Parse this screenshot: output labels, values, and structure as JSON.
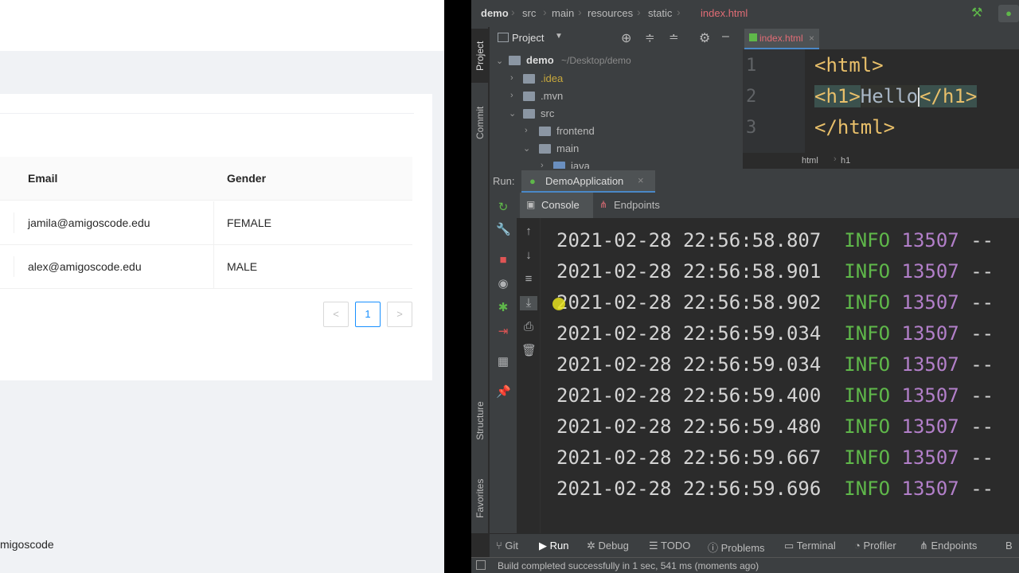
{
  "web": {
    "table": {
      "headers": [
        "Email",
        "Gender"
      ],
      "rows": [
        {
          "email": "jamila@amigoscode.edu",
          "gender": "FEMALE"
        },
        {
          "email": "alex@amigoscode.edu",
          "gender": "MALE"
        }
      ]
    },
    "pagination": {
      "prev": "<",
      "current": "1",
      "next": ">"
    },
    "footer": "migoscode"
  },
  "ide": {
    "breadcrumbs": [
      "demo",
      "src",
      "main",
      "resources",
      "static",
      "index.html"
    ],
    "left_tabs": [
      "Project",
      "Commit",
      "Structure",
      "Favorites"
    ],
    "project": {
      "header": "Project",
      "root_name": "demo",
      "root_path": "~/Desktop/demo",
      "items": [
        ".idea",
        ".mvn",
        "src",
        "frontend",
        "main",
        "java"
      ]
    },
    "editor": {
      "tab": "index.html",
      "line_numbers": [
        "1",
        "2",
        "3"
      ],
      "lines": {
        "l1": "<html>",
        "l2_open": "<h1>",
        "l2_text": "Hello",
        "l2_close": "</h1>",
        "l3": "</html>"
      },
      "crumbs": [
        "html",
        "h1"
      ]
    },
    "run": {
      "label": "Run:",
      "config": "DemoApplication",
      "tabs": [
        "Console",
        "Endpoints"
      ],
      "log": [
        {
          "ts": "2021-02-28 22:56:58.807",
          "level": "INFO",
          "pid": "13507",
          "rest": "--"
        },
        {
          "ts": "2021-02-28 22:56:58.901",
          "level": "INFO",
          "pid": "13507",
          "rest": "--"
        },
        {
          "ts": "2021-02-28 22:56:58.902",
          "level": "INFO",
          "pid": "13507",
          "rest": "--"
        },
        {
          "ts": "2021-02-28 22:56:59.034",
          "level": "INFO",
          "pid": "13507",
          "rest": "--"
        },
        {
          "ts": "2021-02-28 22:56:59.034",
          "level": "INFO",
          "pid": "13507",
          "rest": "--"
        },
        {
          "ts": "2021-02-28 22:56:59.400",
          "level": "INFO",
          "pid": "13507",
          "rest": "--"
        },
        {
          "ts": "2021-02-28 22:56:59.480",
          "level": "INFO",
          "pid": "13507",
          "rest": "--"
        },
        {
          "ts": "2021-02-28 22:56:59.667",
          "level": "INFO",
          "pid": "13507",
          "rest": "--"
        },
        {
          "ts": "2021-02-28 22:56:59.696",
          "level": "INFO",
          "pid": "13507",
          "rest": "--"
        }
      ]
    },
    "bottom_tabs": [
      "Git",
      "Run",
      "Debug",
      "TODO",
      "Problems",
      "Terminal",
      "Profiler",
      "Endpoints",
      "B"
    ],
    "status": "Build completed successfully in 1 sec, 541 ms (moments ago)",
    "colors": {
      "info": "#5fb84a",
      "pid": "#b27fc9",
      "tag": "#e8bf6a",
      "accent": "#1890ff"
    }
  }
}
